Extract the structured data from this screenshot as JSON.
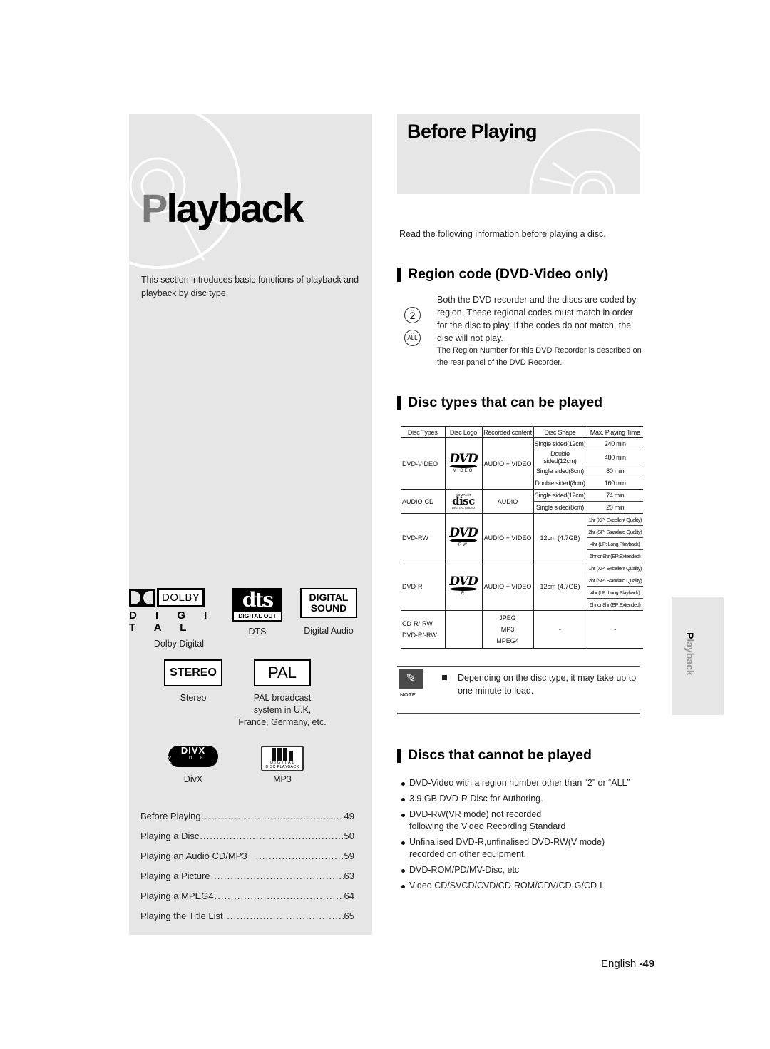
{
  "left_panel": {
    "chapter_title_first": "P",
    "chapter_title_rest": "layback",
    "intro": "This section introduces basic functions of playback and playback by disc type.",
    "logos_row1": [
      {
        "icon": "dolby-digital-logo",
        "logo_top": "DOLBY",
        "logo_bottom": "D I G I T A L",
        "caption": "Dolby Digital"
      },
      {
        "icon": "dts-logo",
        "logo_top": "dts",
        "logo_bottom": "DIGITAL OUT",
        "caption": "DTS"
      },
      {
        "icon": "digital-sound-logo",
        "logo_top": "DIGITAL",
        "logo_bottom": "SOUND",
        "caption": "Digital Audio"
      }
    ],
    "logos_row2": [
      {
        "icon": "stereo-logo",
        "logo_text": "STEREO",
        "caption": "Stereo"
      },
      {
        "icon": "pal-logo",
        "logo_text": "PAL",
        "caption_lines": [
          "PAL broadcast",
          "system in U.K,",
          "France, Germany, etc."
        ]
      }
    ],
    "logos_row3": [
      {
        "icon": "divx-logo",
        "logo_top": "DIVX",
        "logo_bottom": "V I D E O",
        "caption": "DivX"
      },
      {
        "icon": "mp3-logo",
        "logo_sub1": "D I G I T A L",
        "logo_sub2": "DISC PLAYBACK",
        "caption": "MP3"
      }
    ],
    "toc": [
      {
        "label": "Before Playing",
        "page": "49"
      },
      {
        "label": "Playing a Disc",
        "page": "50"
      },
      {
        "label": "Playing an Audio CD/MP3",
        "page": "59"
      },
      {
        "label": "Playing a Picture",
        "page": "63"
      },
      {
        "label": "Playing a MPEG4",
        "page": "64"
      },
      {
        "label": "Playing the Title List",
        "page": "65"
      }
    ]
  },
  "right": {
    "section_title": "Before Playing",
    "intro": "Read the following information before playing a disc.",
    "region": {
      "heading": "Region code (DVD-Video only)",
      "icons": [
        "2",
        "ALL"
      ],
      "body": "Both the DVD recorder and the discs are coded by region. These regional codes must match in order for the disc to play. If the codes do not match, the disc will not play.",
      "body_small": "The Region Number for this DVD Recorder is described on the rear panel of the DVD Recorder."
    },
    "disc_types": {
      "heading": "Disc types that can be played",
      "columns": [
        "Disc Types",
        "Disc Logo",
        "Recorded content",
        "Disc Shape",
        "Max. Playing Time"
      ],
      "rows": [
        {
          "type": "DVD-VIDEO",
          "logo": {
            "word": "DVD",
            "sub": "VIDEO"
          },
          "content": "AUDIO + VIDEO",
          "entries": [
            {
              "shape": "Single sided(12cm)",
              "time": "240 min"
            },
            {
              "shape": "Double sided(12cm)",
              "time": "480 min"
            },
            {
              "shape": "Single sided(8cm)",
              "time": "80 min"
            },
            {
              "shape": "Double sided(8cm)",
              "time": "160 min"
            }
          ]
        },
        {
          "type": "AUDIO-CD",
          "logo": {
            "top": "COMPACT",
            "word": "disc",
            "sub": "DIGITAL AUDIO"
          },
          "content": "AUDIO",
          "entries": [
            {
              "shape": "Single sided(12cm)",
              "time": "74 min"
            },
            {
              "shape": "Single sided(8cm)",
              "time": "20 min"
            }
          ]
        },
        {
          "type": "DVD-RW",
          "logo": {
            "word": "DVD",
            "sub": "RW"
          },
          "content": "AUDIO + VIDEO",
          "shape": "12cm (4.7GB)",
          "times": [
            "1hr (XP: Excellent Quality)",
            "2hr (SP: Standard Quality)",
            "4hr (LP: Long Playback)",
            "6hr or 8hr (EP:Extended)"
          ]
        },
        {
          "type": "DVD-R",
          "logo": {
            "word": "DVD",
            "sub": "R"
          },
          "content": "AUDIO + VIDEO",
          "shape": "12cm (4.7GB)",
          "times": [
            "1hr (XP: Excellent Quality)",
            "2hr (SP: Standard Quality)",
            "4hr (LP: Long Playback)",
            "6hr or 8hr (EP:Extended)"
          ]
        },
        {
          "type_lines": [
            "CD-R/-RW",
            "DVD-R/-RW"
          ],
          "content_lines": [
            "JPEG",
            "MP3",
            "MPEG4"
          ],
          "shape": "-",
          "time": "-"
        }
      ]
    },
    "note": {
      "label": "NOTE",
      "text": "Depending on the disc type, it may take up to one minute to load."
    },
    "cannot": {
      "heading": "Discs that cannot be played",
      "items": [
        "DVD-Video with a region number other than “2” or “ALL”",
        "3.9 GB DVD-R Disc for Authoring.",
        "DVD-RW(VR mode) not recorded following the Video Recording Standard",
        "Unfinalised DVD-R,unfinalised DVD-RW(V mode) recorded on other equipment.",
        "DVD-ROM/PD/MV-Disc, etc",
        "Video CD/SVCD/CVD/CD-ROM/CDV/CD-G/CD-I"
      ]
    }
  },
  "side_tab": {
    "first": "P",
    "rest": "layback"
  },
  "footer": {
    "language": "English",
    "page": "-49"
  }
}
